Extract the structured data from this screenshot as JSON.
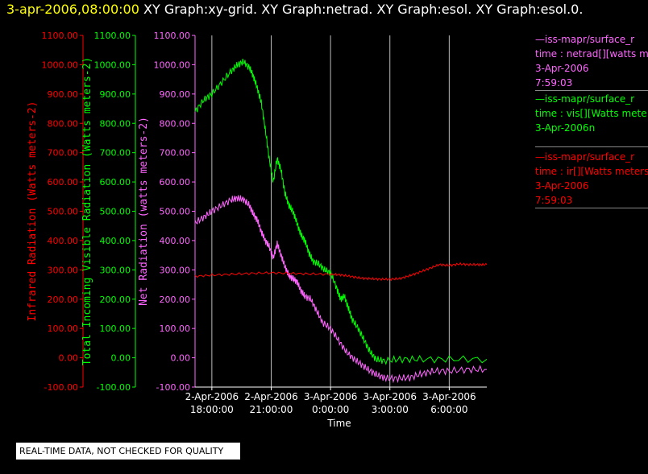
{
  "header": {
    "timestamp": "3-apr-2006,08:00:00",
    "titles": "XY Graph:xy-grid.  XY Graph:netrad.  XY Graph:esol.  XY Graph:esol.0."
  },
  "legend": [
    {
      "color": "#ff66ff",
      "lines": [
        "—iss-mapr/surface_r",
        "time : netrad[][watts m",
        "3-Apr-2006",
        "7:59:03"
      ]
    },
    {
      "color": "#00ff00",
      "lines": [
        "—iss-mapr/surface_r",
        "time : vis[][Watts mete",
        "3-Apr-2006n"
      ]
    },
    {
      "color": "#ff0000",
      "lines": [
        "—iss-mapr/surface_r",
        "time : ir[][Watts meters",
        "3-Apr-2006",
        "7:59:03"
      ]
    }
  ],
  "footer": {
    "qc_note": "REAL-TIME DATA, NOT CHECKED FOR QUALITY"
  },
  "chart_data": {
    "type": "line",
    "xlabel": "Time",
    "x_ticks": [
      {
        "x": 18,
        "l1": "2-Apr-2006",
        "l2": "18:00:00"
      },
      {
        "x": 21,
        "l1": "2-Apr-2006",
        "l2": "21:00:00"
      },
      {
        "x": 24,
        "l1": "3-Apr-2006",
        "l2": "0:00:00"
      },
      {
        "x": 27,
        "l1": "3-Apr-2006",
        "l2": "3:00:00"
      },
      {
        "x": 30,
        "l1": "3-Apr-2006",
        "l2": "6:00:00"
      }
    ],
    "xlim": [
      17.15,
      31.9
    ],
    "grid": "vertical",
    "axes": [
      {
        "label": "Infrared Radiation (Watts meters-2)",
        "color": "#ff0000",
        "ticks": [
          "-100.00",
          "0.00",
          "100.00",
          "200.00",
          "300.00",
          "400.00",
          "500.00",
          "600.00",
          "700.00",
          "800.00",
          "900.00",
          "1000.00",
          "1100.00"
        ]
      },
      {
        "label": "Total Incoming Visible Radiation (Watts meters-2)",
        "color": "#00ff00",
        "ticks": [
          "-100.00",
          "0.00",
          "100.00",
          "200.00",
          "300.00",
          "400.00",
          "500.00",
          "600.00",
          "700.00",
          "800.00",
          "900.00",
          "1000.00",
          "1100.00"
        ]
      },
      {
        "label": "Net Radiation (watts meters-2)",
        "color": "#ff66ff",
        "ticks": [
          "-100.00",
          "0.00",
          "100.00",
          "200.00",
          "300.00",
          "400.00",
          "500.00",
          "600.00",
          "700.00",
          "800.00",
          "900.00",
          "1000.00",
          "1100.00"
        ]
      }
    ],
    "ylim": [
      -100,
      1100
    ],
    "series": [
      {
        "color": "#00ff00",
        "points": [
          [
            17.15,
            840
          ],
          [
            17.6,
            880
          ],
          [
            18.0,
            900
          ],
          [
            18.5,
            940
          ],
          [
            19.0,
            980
          ],
          [
            19.3,
            1000
          ],
          [
            19.6,
            1010
          ],
          [
            19.9,
            990
          ],
          [
            20.1,
            960
          ],
          [
            20.3,
            920
          ],
          [
            20.5,
            870
          ],
          [
            20.7,
            780
          ],
          [
            20.9,
            680
          ],
          [
            21.1,
            600
          ],
          [
            21.3,
            680
          ],
          [
            21.5,
            640
          ],
          [
            21.7,
            560
          ],
          [
            21.9,
            520
          ],
          [
            22.1,
            500
          ],
          [
            22.3,
            460
          ],
          [
            22.5,
            420
          ],
          [
            22.7,
            400
          ],
          [
            22.9,
            360
          ],
          [
            23.1,
            330
          ],
          [
            23.4,
            320
          ],
          [
            23.7,
            300
          ],
          [
            24.0,
            290
          ],
          [
            24.3,
            240
          ],
          [
            24.5,
            200
          ],
          [
            24.7,
            210
          ],
          [
            24.9,
            170
          ],
          [
            25.1,
            130
          ],
          [
            25.4,
            100
          ],
          [
            25.7,
            60
          ],
          [
            26.0,
            20
          ],
          [
            26.3,
            -5
          ],
          [
            26.7,
            -10
          ],
          [
            27.5,
            -5
          ],
          [
            28.5,
            -5
          ],
          [
            30.0,
            -5
          ],
          [
            31.9,
            -5
          ]
        ]
      },
      {
        "color": "#ff66ff",
        "points": [
          [
            17.15,
            460
          ],
          [
            17.6,
            480
          ],
          [
            18.0,
            500
          ],
          [
            18.5,
            520
          ],
          [
            19.0,
            540
          ],
          [
            19.3,
            545
          ],
          [
            19.6,
            540
          ],
          [
            19.9,
            520
          ],
          [
            20.1,
            490
          ],
          [
            20.3,
            470
          ],
          [
            20.5,
            430
          ],
          [
            20.7,
            400
          ],
          [
            20.9,
            380
          ],
          [
            21.1,
            340
          ],
          [
            21.3,
            390
          ],
          [
            21.5,
            350
          ],
          [
            21.7,
            310
          ],
          [
            21.9,
            280
          ],
          [
            22.1,
            270
          ],
          [
            22.3,
            260
          ],
          [
            22.5,
            230
          ],
          [
            22.7,
            210
          ],
          [
            23.0,
            200
          ],
          [
            23.3,
            160
          ],
          [
            23.6,
            120
          ],
          [
            24.0,
            100
          ],
          [
            24.4,
            60
          ],
          [
            24.8,
            20
          ],
          [
            25.2,
            -5
          ],
          [
            25.6,
            -25
          ],
          [
            26.0,
            -45
          ],
          [
            26.4,
            -60
          ],
          [
            26.8,
            -70
          ],
          [
            27.4,
            -70
          ],
          [
            28.0,
            -68
          ],
          [
            28.6,
            -55
          ],
          [
            29.2,
            -45
          ],
          [
            30.0,
            -45
          ],
          [
            31.0,
            -40
          ],
          [
            31.9,
            -40
          ]
        ]
      },
      {
        "color": "#ff0000",
        "points": [
          [
            17.15,
            278
          ],
          [
            18.0,
            282
          ],
          [
            19.0,
            285
          ],
          [
            20.0,
            288
          ],
          [
            21.0,
            290
          ],
          [
            22.0,
            288
          ],
          [
            23.0,
            286
          ],
          [
            24.0,
            285
          ],
          [
            24.5,
            283
          ],
          [
            25.0,
            278
          ],
          [
            25.5,
            272
          ],
          [
            26.0,
            270
          ],
          [
            26.5,
            268
          ],
          [
            27.0,
            268
          ],
          [
            27.5,
            270
          ],
          [
            28.0,
            280
          ],
          [
            28.5,
            292
          ],
          [
            29.0,
            305
          ],
          [
            29.5,
            318
          ],
          [
            30.0,
            315
          ],
          [
            30.5,
            320
          ],
          [
            31.0,
            318
          ],
          [
            31.5,
            318
          ],
          [
            31.9,
            318
          ]
        ]
      }
    ]
  }
}
